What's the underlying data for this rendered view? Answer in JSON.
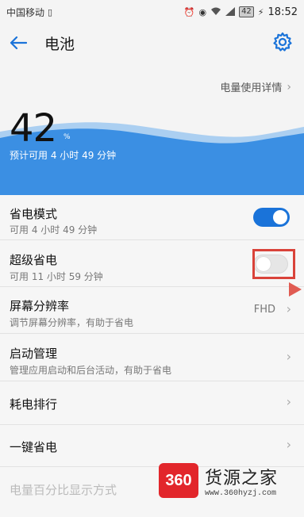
{
  "status_bar": {
    "carrier": "中国移动",
    "battery": "42",
    "time": "18:52"
  },
  "header": {
    "title": "电池"
  },
  "hero": {
    "usage_detail_link": "电量使用详情",
    "battery_percent": "42",
    "percent_sign": "%",
    "remaining_text": "预计可用 4 小时 49 分钟"
  },
  "list": {
    "power_saving": {
      "title": "省电模式",
      "subtitle": "可用 4 小时 49 分钟",
      "enabled": true
    },
    "ultra_saving": {
      "title": "超级省电",
      "subtitle": "可用 11 小时 59 分钟",
      "enabled": false
    },
    "resolution": {
      "title": "屏幕分辨率",
      "subtitle": "调节屏幕分辨率，有助于省电",
      "value": "FHD"
    },
    "startup": {
      "title": "启动管理",
      "subtitle": "管理应用启动和后台活动，有助于省电"
    },
    "ranking": {
      "title": "耗电排行"
    },
    "one_key": {
      "title": "一键省电"
    },
    "percent_display": {
      "title": "电量百分比显示方式"
    }
  },
  "watermark": {
    "logo": "360",
    "title": "货源之家",
    "url": "www.360hyzj.com"
  },
  "colors": {
    "accent": "#1a73d9",
    "wave": "#3b8fe3",
    "annotation": "#d9433a"
  }
}
